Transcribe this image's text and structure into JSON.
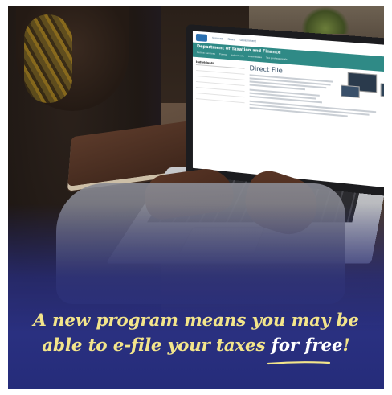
{
  "caption": {
    "line1": "A new program means you may be",
    "line2_prefix": "able to e-file your taxes ",
    "line2_emphasis": "for free",
    "line2_suffix": "!"
  },
  "screen": {
    "top_links": [
      "Services",
      "News",
      "Government"
    ],
    "agency": "Department of Taxation and Finance",
    "nav_items": [
      "Online services",
      "Forms",
      "Individuals",
      "Businesses",
      "Tax professionals"
    ],
    "sidebar_title": "Individuals",
    "page_heading": "Direct File"
  },
  "colors": {
    "caption_text": "#f3e58b",
    "caption_emphasis": "#ffffff",
    "overlay_blue": "#2a3080",
    "site_banner": "#2f8a86"
  }
}
